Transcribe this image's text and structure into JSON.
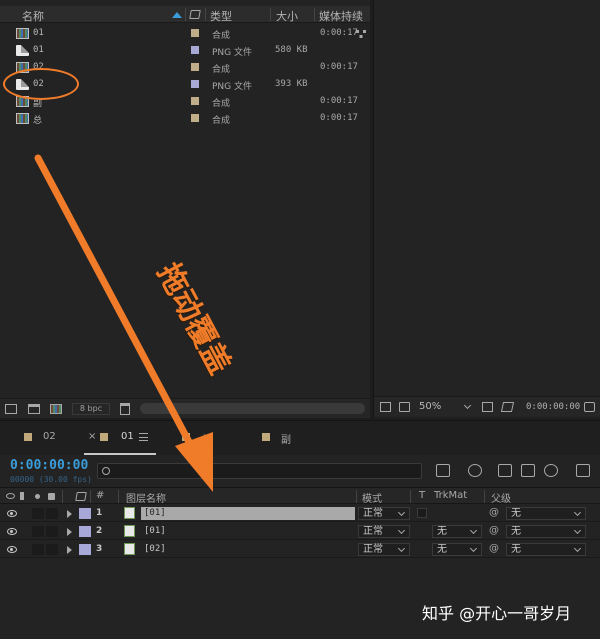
{
  "project": {
    "columns": {
      "name": "名称",
      "type": "类型",
      "size": "大小",
      "duration": "媒体持续"
    },
    "items": [
      {
        "name": "01",
        "kind": "comp",
        "label_color": "#bfae88",
        "type": "合成",
        "size": "",
        "duration": "0:00:17"
      },
      {
        "name": "01",
        "kind": "file",
        "label_color": "#a9a9d6",
        "type": "PNG 文件",
        "size": "580 KB",
        "duration": ""
      },
      {
        "name": "02",
        "kind": "comp",
        "label_color": "#bfae88",
        "type": "合成",
        "size": "",
        "duration": "0:00:17"
      },
      {
        "name": "02",
        "kind": "file",
        "label_color": "#a9a9d6",
        "type": "PNG 文件",
        "size": "393 KB",
        "duration": ""
      },
      {
        "name": "副",
        "kind": "comp",
        "label_color": "#bfae88",
        "type": "合成",
        "size": "",
        "duration": "0:00:17"
      },
      {
        "name": "总",
        "kind": "comp",
        "label_color": "#bfae88",
        "type": "合成",
        "size": "",
        "duration": "0:00:17"
      }
    ],
    "footer": {
      "bpc": "8 bpc"
    }
  },
  "viewer": {
    "zoom": "50%",
    "time": "0:00:00:00"
  },
  "timeline": {
    "tabs": [
      {
        "label": "02",
        "color": "#c1a97c"
      },
      {
        "label": "01",
        "color": "#c1a97c",
        "active": true
      },
      {
        "label": "总",
        "color": "#c1a97c"
      },
      {
        "label": "副",
        "color": "#c1a97c"
      }
    ],
    "close_glyph": "×",
    "timecode": "0:00:00:00",
    "fps": "00000 (30.00 fps)",
    "search_placeholder": "",
    "columns": {
      "hash": "#",
      "layer_name": "图层名称",
      "mode": "模式",
      "t": "T",
      "trkmat": "TrkMat",
      "parent": "父级"
    },
    "layers": [
      {
        "num": "1",
        "name": "[01]",
        "mode": "正常",
        "trkmat": "",
        "parent": "无",
        "selected": true
      },
      {
        "num": "2",
        "name": "[01]",
        "mode": "正常",
        "trkmat": "无",
        "parent": "无",
        "selected": false
      },
      {
        "num": "3",
        "name": "[02]",
        "mode": "正常",
        "trkmat": "无",
        "parent": "无",
        "selected": false
      }
    ]
  },
  "annotation": {
    "text": "拖动覆盖",
    "color": "#f07c2a"
  },
  "watermark": "知乎 @开心一哥岁月"
}
